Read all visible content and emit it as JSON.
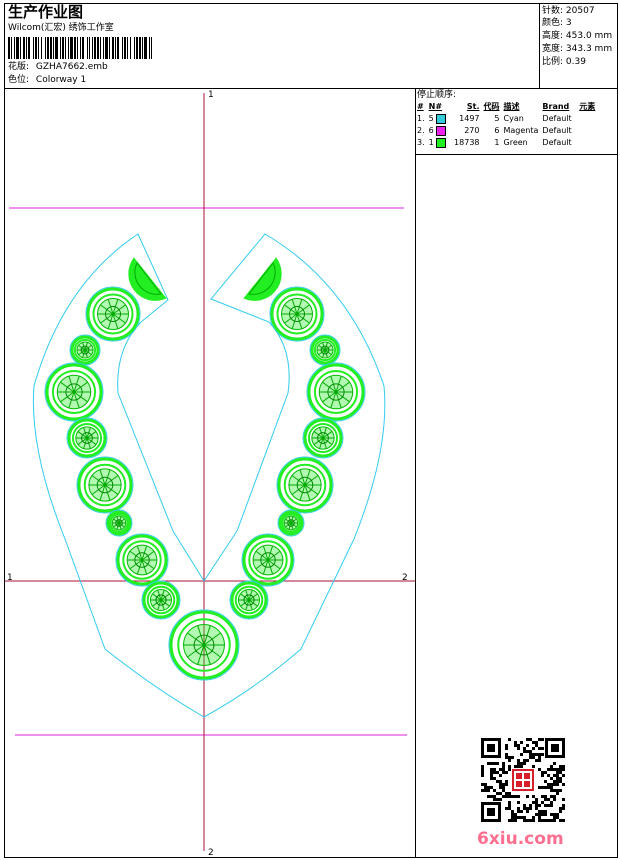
{
  "header": {
    "title": "生产作业图",
    "company": "Wilcom(汇宏) 绣饰工作室",
    "design_label": "花版:",
    "design_value": "GZHA7662.emb",
    "colorway_label": "色位:",
    "colorway_value": "Colorway 1"
  },
  "specs": [
    {
      "label": "针数:",
      "value": "20507"
    },
    {
      "label": "颜色:",
      "value": "3"
    },
    {
      "label": "高度:",
      "value": "453.0 mm"
    },
    {
      "label": "宽度:",
      "value": "343.3 mm"
    },
    {
      "label": "比例:",
      "value": "0.39"
    }
  ],
  "stop_sequence": {
    "title": "停止顺序:",
    "headers": [
      "#",
      "N#",
      "St.",
      "代码",
      "描述",
      "Brand",
      "元素"
    ],
    "rows": [
      {
        "idx": "1.",
        "n": "5",
        "swatch": "#33ccdd",
        "st": "1497",
        "code": "5",
        "desc": "Cyan",
        "brand": "Default"
      },
      {
        "idx": "2.",
        "n": "6",
        "swatch": "#ee22ee",
        "st": "270",
        "code": "6",
        "desc": "Magenta",
        "brand": "Default"
      },
      {
        "idx": "3.",
        "n": "1",
        "swatch": "#22ee22",
        "st": "18738",
        "code": "1",
        "desc": "Green",
        "brand": "Default"
      }
    ]
  },
  "guides": {
    "top_marker": "1",
    "bottom_marker": "2",
    "left_marker": "1",
    "right_marker": "2"
  },
  "colors": {
    "green": "#22ee22",
    "cyan": "#33ccee",
    "magenta": "#dd22dd",
    "crimson": "#aa1133"
  },
  "watermark": "6xiu.com",
  "icons": {
    "qr": "qr-code-icon",
    "seal": "seal-stamp-icon"
  }
}
